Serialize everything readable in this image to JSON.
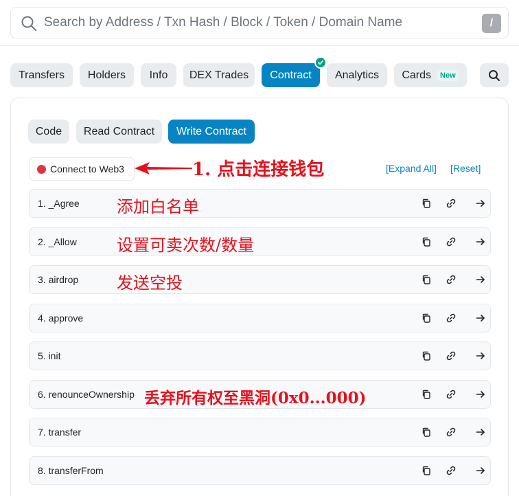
{
  "search": {
    "placeholder": "Search by Address / Txn Hash / Block / Token / Domain Name",
    "shortcut_key": "/"
  },
  "nav_tabs": [
    {
      "label": "Transfers"
    },
    {
      "label": "Holders"
    },
    {
      "label": "Info"
    },
    {
      "label": "DEX Trades"
    },
    {
      "label": "Contract",
      "active": true,
      "verified_badge": "check-icon"
    },
    {
      "label": "Analytics"
    },
    {
      "label": "Cards",
      "badge": "New"
    }
  ],
  "sub_tabs": [
    {
      "label": "Code"
    },
    {
      "label": "Read Contract"
    },
    {
      "label": "Write Contract",
      "active": true
    }
  ],
  "connect": {
    "label": "Connect to Web3",
    "status_color": "#dc3545"
  },
  "links": {
    "expand_all": "[Expand All]",
    "reset": "[Reset]"
  },
  "annotations": {
    "connect_hint": "1. 点击连接钱包",
    "agree_hint": "添加白名单",
    "allow_hint": "设置可卖次数/数量",
    "airdrop_hint": "发送空投",
    "renounce_hint": "丢弃所有权至黑洞(0x0...000)",
    "color": "#e8101c"
  },
  "functions": [
    {
      "label": "1. _Agree"
    },
    {
      "label": "2. _Allow"
    },
    {
      "label": "3. airdrop"
    },
    {
      "label": "4. approve"
    },
    {
      "label": "5. init"
    },
    {
      "label": "6. renounceOwnership"
    },
    {
      "label": "7. transfer"
    },
    {
      "label": "8. transferFrom"
    }
  ],
  "row_icons": [
    "copy-icon",
    "link-icon",
    "arrow-right-icon"
  ],
  "colors": {
    "accent": "#0784c3",
    "tab_bg": "#e9ecef",
    "verified": "#00a186"
  }
}
